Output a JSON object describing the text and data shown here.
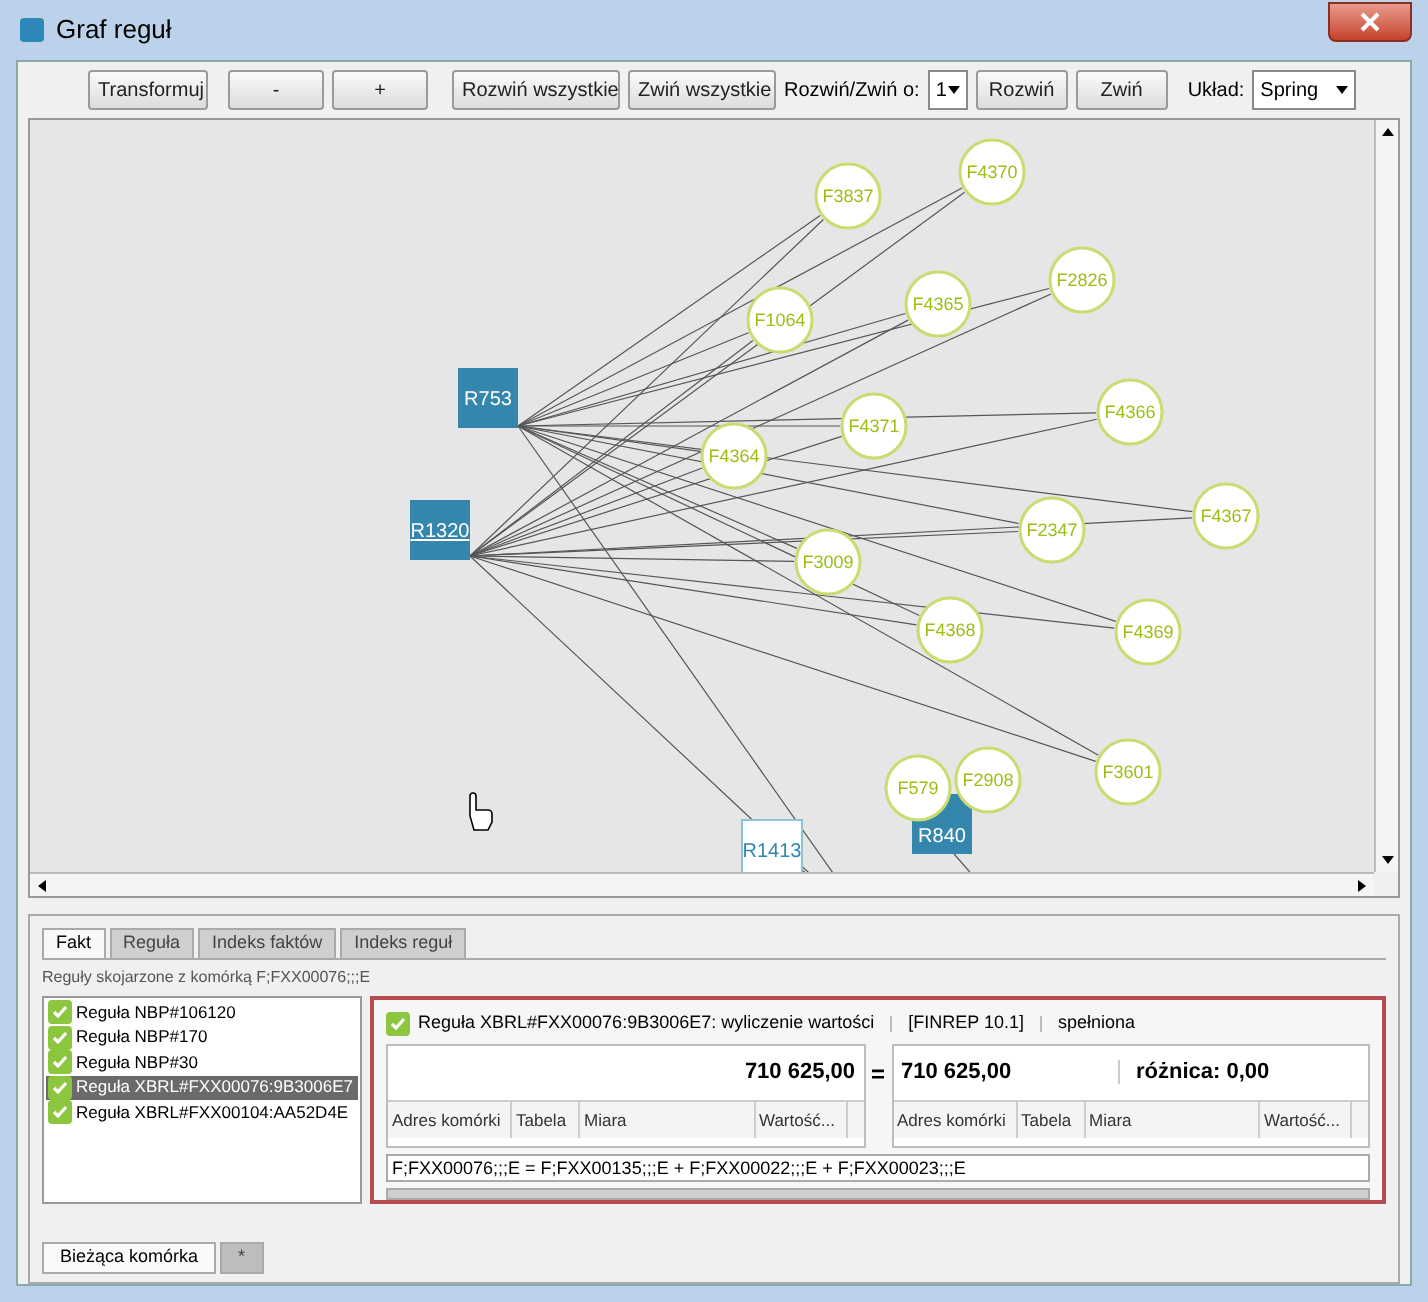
{
  "window": {
    "title": "Graf reguł"
  },
  "toolbar": {
    "buttons": [
      "Transformuj",
      "-",
      "+",
      "Rozwiń wszystkie",
      "Zwiń wszystkie"
    ],
    "depth_label": "Rozwiń/Zwiń o:",
    "depth_value": "1",
    "depth_buttons": [
      "Rozwiń",
      "Zwiń"
    ],
    "layout_label": "Układ:",
    "layout_value": "Spring"
  },
  "graph": {
    "nodes": [
      {
        "label": "R753",
        "kind": "rule",
        "underlined": false
      },
      {
        "label": "R1320",
        "kind": "rule",
        "underlined": true
      },
      {
        "label": "R1413",
        "kind": "rule-outline",
        "underlined": false
      },
      {
        "label": "R840",
        "kind": "rule",
        "underlined": false
      },
      {
        "label": "F3837",
        "kind": "fact",
        "underlined": false
      },
      {
        "label": "F4370",
        "kind": "fact",
        "underlined": false
      },
      {
        "label": "F1064",
        "kind": "fact",
        "underlined": false
      },
      {
        "label": "F4365",
        "kind": "fact",
        "underlined": false
      },
      {
        "label": "F2826",
        "kind": "fact",
        "underlined": false
      },
      {
        "label": "F4364",
        "kind": "fact",
        "underlined": false
      },
      {
        "label": "F4371",
        "kind": "fact",
        "underlined": false
      },
      {
        "label": "F4366",
        "kind": "fact",
        "underlined": false
      },
      {
        "label": "F4367",
        "kind": "fact",
        "underlined": false
      },
      {
        "label": "F2347",
        "kind": "fact",
        "underlined": false
      },
      {
        "label": "F3009",
        "kind": "fact",
        "underlined": false
      },
      {
        "label": "F4368",
        "kind": "fact",
        "underlined": false
      },
      {
        "label": "F4369",
        "kind": "fact",
        "underlined": false
      },
      {
        "label": "F3601",
        "kind": "fact",
        "underlined": false
      },
      {
        "label": "F579",
        "kind": "fact",
        "underlined": false
      },
      {
        "label": "F2908",
        "kind": "fact",
        "underlined": false
      }
    ]
  },
  "tabs": [
    {
      "label": "Fakt",
      "selected": true
    },
    {
      "label": "Reguła",
      "selected": false
    },
    {
      "label": "Indeks faktów",
      "selected": false
    },
    {
      "label": "Indeks reguł",
      "selected": false
    }
  ],
  "caption": "Reguły skojarzone z komórką F;FXX00076;;;E",
  "rules": [
    {
      "label": "Reguła NBP#106120",
      "checked": true,
      "selected": false
    },
    {
      "label": "Reguła NBP#170",
      "checked": true,
      "selected": false
    },
    {
      "label": "Reguła NBP#30",
      "checked": true,
      "selected": false
    },
    {
      "label": "Reguła XBRL#FXX00076:9B3006E7",
      "checked": true,
      "selected": true
    },
    {
      "label": "Reguła XBRL#FXX00104:AA52D4E",
      "checked": true,
      "selected": false
    }
  ],
  "detail": {
    "checked": true,
    "title": "Reguła XBRL#FXX00076:9B3006E7: wyliczenie wartości",
    "template": "[FINREP 10.1]",
    "status": "spełniona",
    "left": {
      "total": "710 625,00",
      "columns": [
        "Adres komórki",
        "Tabela",
        "Miara",
        "Wartość..."
      ]
    },
    "equals": "=",
    "right": {
      "total": "710 625,00",
      "difference": "różnica: 0,00",
      "columns": [
        "Adres komórki",
        "Tabela",
        "Miara",
        "Wartość..."
      ]
    },
    "formula": "F;FXX00076;;;E = F;FXX00135;;;E + F;FXX00022;;;E + F;FXX00023;;;E"
  },
  "bottom_tabs": [
    {
      "label": "Bieżąca komórka",
      "selected": true
    },
    {
      "label": "*",
      "selected": false
    }
  ]
}
